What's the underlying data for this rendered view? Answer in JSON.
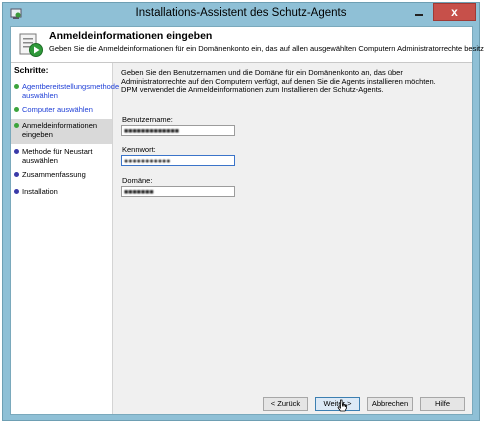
{
  "window": {
    "title": "Installations-Assistent des Schutz-Agents",
    "close_label": "x"
  },
  "header": {
    "title": "Anmeldeinformationen eingeben",
    "subtitle": "Geben Sie die Anmeldeinformationen für ein Domänenkonto ein, das auf allen ausgewählten Computern Administratorrechte besitzt."
  },
  "steps": {
    "title": "Schritte:",
    "items": [
      {
        "label": "Agentbereitstellungsmethode auswählen",
        "state": "done"
      },
      {
        "label": "Computer auswählen",
        "state": "done"
      },
      {
        "label": "Anmeldeinformationen eingeben",
        "state": "current"
      },
      {
        "label": "Methode für Neustart auswählen",
        "state": "pending"
      },
      {
        "label": "Zusammenfassung",
        "state": "pending"
      },
      {
        "label": "Installation",
        "state": "pending"
      }
    ]
  },
  "content": {
    "intro_line1": "Geben Sie den Benutzernamen und die Domäne für ein Domänenkonto an, das über Administratorrechte auf den Computern verfügt, auf denen Sie die Agents installieren möchten.",
    "intro_line2": "DPM verwendet die Anmeldeinformationen zum Installieren der Schutz-Agents.",
    "username_label": "Benutzername:",
    "username_value": "■■■■■■■■■■■■■",
    "password_label": "Kennwort:",
    "password_value": "●●●●●●●●●●●",
    "domain_label": "Domäne:",
    "domain_value": "■■■■■■■"
  },
  "buttons": {
    "back": "< Zurück",
    "next": "Weiter >",
    "cancel": "Abbrechen",
    "help": "Hilfe"
  },
  "icons": {
    "window": "wizard-app-icon",
    "header": "agent-install-icon",
    "cursor": "mouse-cursor-icon"
  },
  "colors": {
    "titlebar": "#8fc0d6",
    "close_button": "#c7504a",
    "done_step_text": "#1f3fd6",
    "done_dot": "#3ca43c",
    "pending_dot": "#3a3aa8"
  }
}
